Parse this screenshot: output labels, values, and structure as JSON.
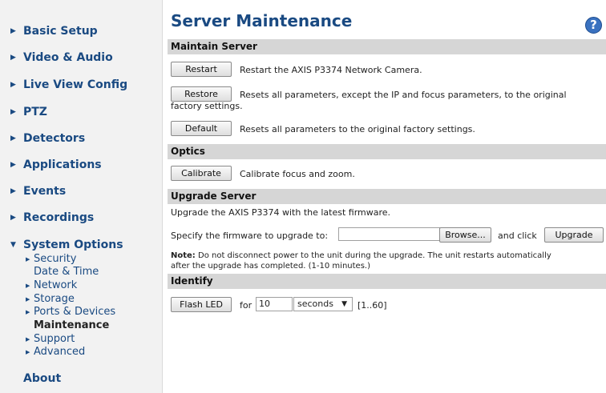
{
  "sidebar": {
    "items": [
      {
        "label": "Basic Setup"
      },
      {
        "label": "Video & Audio"
      },
      {
        "label": "Live View Config"
      },
      {
        "label": "PTZ"
      },
      {
        "label": "Detectors"
      },
      {
        "label": "Applications"
      },
      {
        "label": "Events"
      },
      {
        "label": "Recordings"
      },
      {
        "label": "System Options"
      }
    ],
    "sub_items": [
      {
        "label": "Security"
      },
      {
        "label": "Date & Time"
      },
      {
        "label": "Network"
      },
      {
        "label": "Storage"
      },
      {
        "label": "Ports & Devices"
      },
      {
        "label": "Maintenance"
      },
      {
        "label": "Support"
      },
      {
        "label": "Advanced"
      }
    ],
    "about": "About"
  },
  "main": {
    "title": "Server Maintenance",
    "help_icon": "?",
    "maintain": {
      "heading": "Maintain Server",
      "restart_label": "Restart",
      "restart_desc": "Restart the AXIS P3374 Network Camera.",
      "restore_label": "Restore",
      "restore_desc_line1": "Resets all parameters, except the IP and focus parameters, to the original",
      "restore_desc_line2": "factory settings.",
      "default_label": "Default",
      "default_desc": "Resets all parameters to the original factory settings."
    },
    "optics": {
      "heading": "Optics",
      "calibrate_label": "Calibrate",
      "calibrate_desc": "Calibrate focus and zoom."
    },
    "upgrade": {
      "heading": "Upgrade Server",
      "intro": "Upgrade the AXIS P3374 with the latest firmware.",
      "specify": "Specify the firmware to upgrade to:",
      "firmware_value": "",
      "browse_label": "Browse...",
      "and_click": "and click",
      "upgrade_label": "Upgrade",
      "note_bold": "Note:",
      "note_line1": "Do not disconnect power to the unit during the upgrade. The unit restarts automatically",
      "note_line2": "after the upgrade has completed. (1-10 minutes.)"
    },
    "identify": {
      "heading": "Identify",
      "flash_label": "Flash LED",
      "for": "for",
      "duration_value": "10",
      "unit_selected": "seconds",
      "range": "[1..60]"
    }
  }
}
